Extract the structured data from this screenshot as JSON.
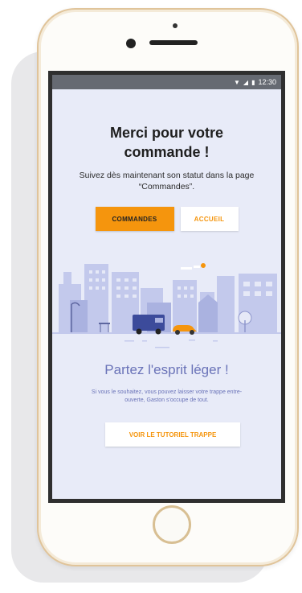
{
  "status_bar": {
    "time": "12:30"
  },
  "confirmation": {
    "title": "Merci pour votre commande !",
    "subtitle": "Suivez dès maintenant son statut dans la page “Commandes”.",
    "primary_button": "COMMANDES",
    "secondary_button": "ACCUEIL"
  },
  "info": {
    "heading": "Partez l'esprit léger !",
    "body": "Si vous le souhaitez, vous pouvez laisser votre trappe entre-ouverte, Gaston s'occupe de tout.",
    "tutorial_button": "VOIR LE TUTORIEL TRAPPE"
  },
  "colors": {
    "accent": "#f5950d",
    "screen_bg": "#e8ebf8",
    "illustration_blue": "#b8bfe6",
    "heading_blue": "#6a73b8",
    "phone_frame_gold": "#e0c49a"
  },
  "icons": [
    "wifi-icon",
    "signal-icon",
    "battery-icon"
  ]
}
